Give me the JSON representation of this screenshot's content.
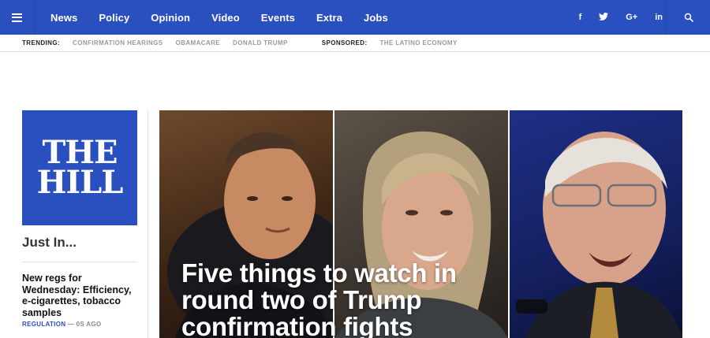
{
  "nav": {
    "links": [
      "News",
      "Policy",
      "Opinion",
      "Video",
      "Events",
      "Extra",
      "Jobs"
    ],
    "social": [
      "f",
      "t",
      "G+",
      "in"
    ]
  },
  "trending": {
    "label": "TRENDING:",
    "items": [
      "CONFIRMATION HEARINGS",
      "OBAMACARE",
      "DONALD TRUMP"
    ],
    "sponsored_label": "SPONSORED:",
    "sponsored_item": "THE LATINO ECONOMY"
  },
  "logo": {
    "line1": "THE",
    "line2": "HILL"
  },
  "sidebar": {
    "heading": "Just In...",
    "story": {
      "title": "New regs for Wednesday: Efficiency, e-cigarettes, tobacco samples",
      "category": "REGULATION",
      "time": "— 0S AGO"
    }
  },
  "hero": {
    "headline": "Five things to watch in round two of Trump confirmation fights"
  },
  "colors": {
    "brand": "#2a4fbf",
    "trending_gray": "#9a9a9a"
  }
}
